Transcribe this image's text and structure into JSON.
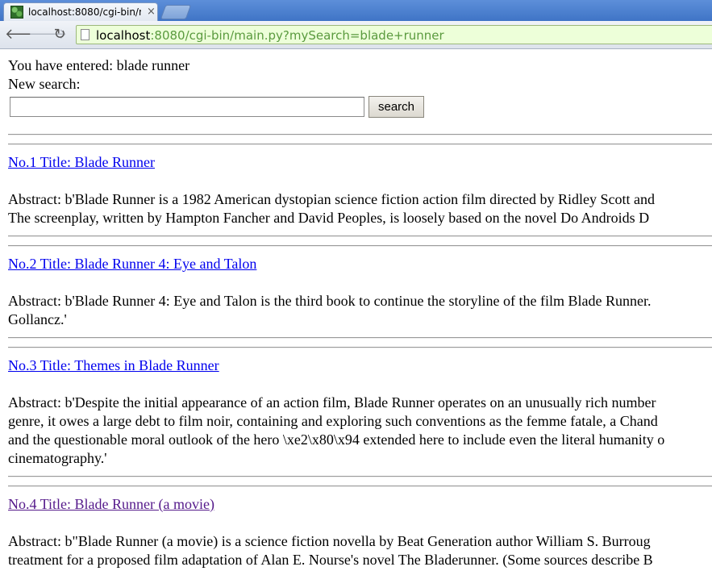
{
  "browser": {
    "tab_title": "localhost:8080/cgi-bin/m",
    "tab_close": "×",
    "url_host": "localhost",
    "url_rest": ":8080/cgi-bin/main.py?mySearch=blade+runner",
    "back_icon": "🡐",
    "forward_icon": "🡒",
    "reload_icon": "↻"
  },
  "page": {
    "entered_text": "You have entered: blade runner",
    "new_search_label": "New search:",
    "search_input_value": "",
    "search_button_label": "search"
  },
  "results": [
    {
      "title": "No.1 Title: Blade Runner ",
      "abstract_lines": [
        "Abstract: b'Blade Runner is a 1982 American dystopian science fiction action film directed by Ridley Scott and",
        "The screenplay, written by Hampton Fancher and David Peoples, is loosely based on the novel Do Androids D"
      ]
    },
    {
      "title": "No.2 Title: Blade Runner 4: Eye and Talon ",
      "abstract_lines": [
        "Abstract: b'Blade Runner 4: Eye and Talon is the third book to continue the storyline of the film Blade Runner.",
        "Gollancz.'"
      ]
    },
    {
      "title": "No.3 Title: Themes in Blade Runner ",
      "abstract_lines": [
        "Abstract: b'Despite the initial appearance of an action film, Blade Runner operates on an unusually rich number",
        "genre, it owes a large debt to film noir, containing and exploring such conventions as the femme fatale, a Chand",
        "and the questionable moral outlook of the hero \\xe2\\x80\\x94 extended here to include even the literal humanity o",
        "cinematography.'"
      ]
    },
    {
      "title": "No.4 Title: Blade Runner (a movie) ",
      "abstract_lines": [
        "Abstract: b\"Blade Runner (a movie) is a science fiction novella by Beat Generation author William S. Burroug",
        "treatment for a proposed film adaptation of Alan E. Nourse's novel The Bladerunner. (Some sources describe B"
      ]
    }
  ]
}
